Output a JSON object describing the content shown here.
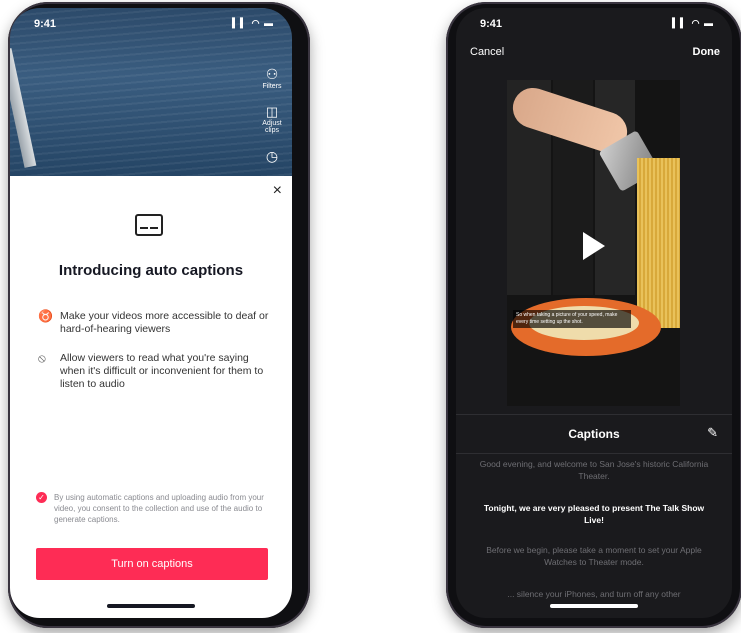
{
  "left_phone": {
    "status": {
      "time": "9:41",
      "signal": "▍▍ ◠ ▬"
    },
    "side_tools": [
      {
        "icon": "filters-icon",
        "label": "Filters"
      },
      {
        "icon": "adjust-clips-icon",
        "label": "Adjust clips"
      },
      {
        "icon": "timer-icon",
        "label": ""
      }
    ],
    "sheet": {
      "close": "×",
      "title": "Introducing auto captions",
      "features": [
        {
          "icon": "ear-icon",
          "text": "Make your videos more accessible to deaf or hard-of-hearing viewers"
        },
        {
          "icon": "mute-icon",
          "text": "Allow viewers to read what you're saying when it's difficult or inconvenient for them to listen to audio"
        }
      ],
      "consent": "By using automatic captions and uploading audio from your video, you consent to the collection and use of the audio to generate captions.",
      "button": "Turn on captions"
    }
  },
  "right_phone": {
    "status": {
      "time": "9:41",
      "signal": "▍▍ ◠ ▬"
    },
    "topbar": {
      "cancel": "Cancel",
      "done": "Done"
    },
    "video_caption": "So when taking a picture of your speed, make every time setting up the shot.",
    "captions_label": "Captions",
    "caption_lines": [
      "Good evening, and welcome to San Jose's historic California Theater.",
      "Tonight, we are very pleased to present The Talk Show Live!",
      "Before we begin, please take a moment to set your Apple Watches to Theater mode.",
      "... silence your iPhones, and turn off any other"
    ]
  }
}
